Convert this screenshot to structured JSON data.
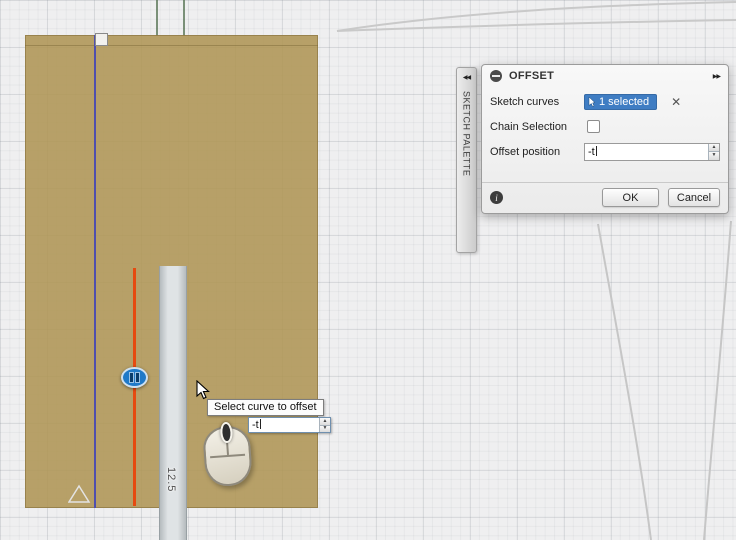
{
  "icons": {
    "collapse": "◀◀",
    "expand": "▶▶",
    "close": "✕",
    "info": "i",
    "spin_up": "▲",
    "spin_down": "▼"
  },
  "canvas": {
    "tooltip": "Select curve to offset",
    "inline_value": "-t",
    "dimension": "12.5"
  },
  "palette": {
    "title": "SKETCH PALETTE"
  },
  "dialog": {
    "title": "OFFSET",
    "rows": {
      "sketch_curves_label": "Sketch curves",
      "selection": "1 selected",
      "chain_label": "Chain Selection",
      "offset_label": "Offset position",
      "offset_value": "-t"
    },
    "buttons": {
      "ok": "OK",
      "cancel": "Cancel"
    }
  },
  "colors": {
    "selection_blue": "#3f7dc3",
    "preview_red": "#e64a10",
    "line_purple": "#4f4fae",
    "region_tan": "#af9554"
  }
}
